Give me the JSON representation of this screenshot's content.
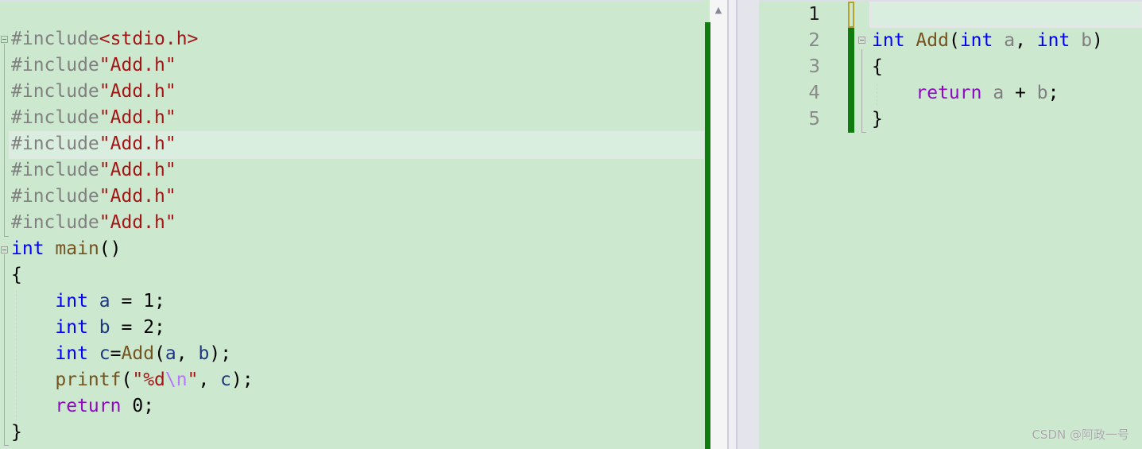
{
  "left_editor": {
    "lines": [
      [
        {
          "t": "#include",
          "c": "pre"
        },
        {
          "t": "<stdio.h>",
          "c": "str"
        }
      ],
      [
        {
          "t": "#include",
          "c": "pre"
        },
        {
          "t": "\"Add.h\"",
          "c": "str"
        }
      ],
      [
        {
          "t": "#include",
          "c": "pre"
        },
        {
          "t": "\"Add.h\"",
          "c": "str"
        }
      ],
      [
        {
          "t": "#include",
          "c": "pre"
        },
        {
          "t": "\"Add.h\"",
          "c": "str"
        }
      ],
      [
        {
          "t": "#include",
          "c": "pre"
        },
        {
          "t": "\"Add.h\"",
          "c": "str"
        }
      ],
      [
        {
          "t": "#include",
          "c": "pre"
        },
        {
          "t": "\"Add.h\"",
          "c": "str"
        }
      ],
      [
        {
          "t": "#include",
          "c": "pre"
        },
        {
          "t": "\"Add.h\"",
          "c": "str"
        }
      ],
      [
        {
          "t": "#include",
          "c": "pre"
        },
        {
          "t": "\"Add.h\"",
          "c": "str"
        }
      ],
      [
        {
          "t": "int",
          "c": "kw"
        },
        {
          "t": " ",
          "c": "plain"
        },
        {
          "t": "main",
          "c": "fn"
        },
        {
          "t": "()",
          "c": "plain"
        }
      ],
      [
        {
          "t": "{",
          "c": "plain"
        }
      ],
      [
        {
          "t": "    ",
          "c": "plain"
        },
        {
          "t": "int",
          "c": "kw"
        },
        {
          "t": " ",
          "c": "plain"
        },
        {
          "t": "a",
          "c": "var"
        },
        {
          "t": " = 1;",
          "c": "plain"
        }
      ],
      [
        {
          "t": "    ",
          "c": "plain"
        },
        {
          "t": "int",
          "c": "kw"
        },
        {
          "t": " ",
          "c": "plain"
        },
        {
          "t": "b",
          "c": "var"
        },
        {
          "t": " = 2;",
          "c": "plain"
        }
      ],
      [
        {
          "t": "    ",
          "c": "plain"
        },
        {
          "t": "int",
          "c": "kw"
        },
        {
          "t": " ",
          "c": "plain"
        },
        {
          "t": "c",
          "c": "var"
        },
        {
          "t": "=",
          "c": "plain"
        },
        {
          "t": "Add",
          "c": "fn"
        },
        {
          "t": "(",
          "c": "plain"
        },
        {
          "t": "a",
          "c": "var"
        },
        {
          "t": ", ",
          "c": "plain"
        },
        {
          "t": "b",
          "c": "var"
        },
        {
          "t": ");",
          "c": "plain"
        }
      ],
      [
        {
          "t": "    ",
          "c": "plain"
        },
        {
          "t": "printf",
          "c": "fn"
        },
        {
          "t": "(",
          "c": "plain"
        },
        {
          "t": "\"%d",
          "c": "str"
        },
        {
          "t": "\\n",
          "c": "esc"
        },
        {
          "t": "\"",
          "c": "str"
        },
        {
          "t": ", ",
          "c": "plain"
        },
        {
          "t": "c",
          "c": "var"
        },
        {
          "t": ");",
          "c": "plain"
        }
      ],
      [
        {
          "t": "    ",
          "c": "plain"
        },
        {
          "t": "return",
          "c": "ctl"
        },
        {
          "t": " 0;",
          "c": "plain"
        }
      ],
      [
        {
          "t": "}",
          "c": "plain"
        }
      ]
    ],
    "current_line_index": 4
  },
  "right_editor": {
    "line_numbers": [
      "1",
      "2",
      "3",
      "4",
      "5"
    ],
    "current_line_number": "1",
    "lines": [
      [],
      [
        {
          "t": "int",
          "c": "kw"
        },
        {
          "t": " ",
          "c": "plain"
        },
        {
          "t": "Add",
          "c": "fn"
        },
        {
          "t": "(",
          "c": "plain"
        },
        {
          "t": "int",
          "c": "kw"
        },
        {
          "t": " ",
          "c": "plain"
        },
        {
          "t": "a",
          "c": "param"
        },
        {
          "t": ", ",
          "c": "plain"
        },
        {
          "t": "int",
          "c": "kw"
        },
        {
          "t": " ",
          "c": "plain"
        },
        {
          "t": "b",
          "c": "param"
        },
        {
          "t": ")",
          "c": "plain"
        }
      ],
      [
        {
          "t": "{",
          "c": "plain"
        }
      ],
      [
        {
          "t": "    ",
          "c": "plain"
        },
        {
          "t": "return",
          "c": "ctl"
        },
        {
          "t": " ",
          "c": "plain"
        },
        {
          "t": "a",
          "c": "param"
        },
        {
          "t": " + ",
          "c": "plain"
        },
        {
          "t": "b",
          "c": "param"
        },
        {
          "t": ";",
          "c": "plain"
        }
      ],
      [
        {
          "t": "}",
          "c": "plain"
        }
      ]
    ]
  },
  "scrollbar": {
    "up_arrow_icon": "▲"
  },
  "watermark": "CSDN @阿政一号"
}
